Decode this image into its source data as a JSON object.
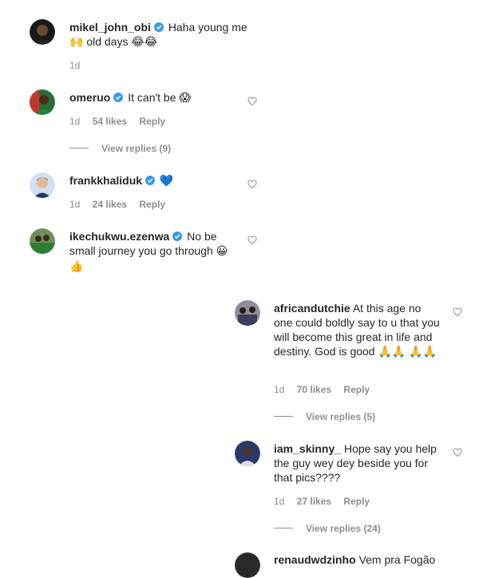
{
  "colors": {
    "verified": "#3897f0",
    "muted": "#8e8e8e",
    "text": "#262626"
  },
  "comments": [
    {
      "username": "mikel_john_obi",
      "text": "Haha young me",
      "emoji_inline": "🙌",
      "text2": "old days",
      "emoji_end": "😂😂",
      "time": "1d"
    },
    {
      "username": "omeruo",
      "text": "It can't be",
      "emoji_end": "😱",
      "time": "1d",
      "likes": "54 likes",
      "reply": "Reply",
      "view_replies": "View replies (9)"
    },
    {
      "username": "frankkhaliduk",
      "emoji_end": "💙",
      "time": "1d",
      "likes": "24 likes",
      "reply": "Reply"
    },
    {
      "username": "ikechukwu.ezenwa",
      "text": "No be small journey you go through",
      "emoji_mid": "😀",
      "emoji_end": "👍"
    }
  ],
  "replies": [
    {
      "username": "africandutchie",
      "text": "At this age no one could boldly say to u that you will become this great in life and destiny. God is good",
      "emoji_end": "🙏🙏",
      "emoji_line2": "🙏🙏",
      "time": "1d",
      "likes": "70 likes",
      "reply": "Reply",
      "view_replies": "View replies (5)"
    },
    {
      "username": "iam_skinny_",
      "text": "Hope say you help the guy wey dey beside you for that pics????",
      "time": "1d",
      "likes": "27 likes",
      "reply": "Reply",
      "view_replies": "View replies (24)"
    },
    {
      "username": "renaudwdzinho",
      "text": "Vem pra Fogão"
    }
  ]
}
